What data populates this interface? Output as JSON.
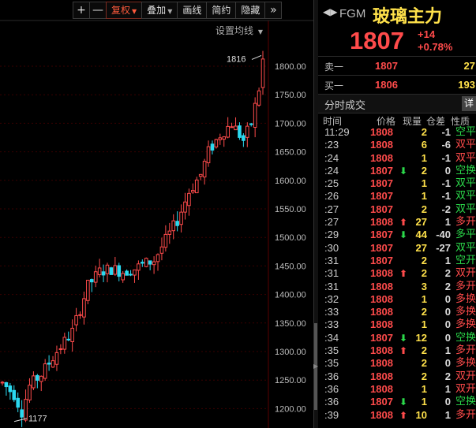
{
  "toolbar": {
    "zoom_in": "+",
    "zoom_out": "—",
    "adjust_label": "复权",
    "overlay_label": "叠加",
    "draw_label": "画线",
    "simple_label": "简约",
    "hide_label": "隐藏",
    "more_label": "»"
  },
  "ma_setting_label": "设置均线",
  "price_axis": [
    "1800.00",
    "1750.00",
    "1700.00",
    "1650.00",
    "1600.00",
    "1550.00",
    "1500.00",
    "1450.00",
    "1400.00",
    "1350.00",
    "1300.00",
    "1250.00",
    "1200.00"
  ],
  "chart_marks": {
    "high_label": "1816",
    "low_label": "1177"
  },
  "colors": {
    "up": "#ff4b4b",
    "down": "#2bd9f0",
    "gridline": "#3a0000",
    "name": "#ffe14a",
    "sell_green": "#2bd94a"
  },
  "header": {
    "arrows": "◀▶",
    "code": "FGM",
    "name": "玻璃主力",
    "price": "1807",
    "change": "+14",
    "change_pct": "+0.78%"
  },
  "sell1": {
    "label": "卖一",
    "price": "1807",
    "volume": "27"
  },
  "buy1": {
    "label": "买一",
    "price": "1806",
    "volume": "193"
  },
  "trades": {
    "title": "分时成交",
    "detail_label": "详",
    "columns": {
      "time": "时间",
      "price": "价格",
      "volume": "现量",
      "oi": "仓差",
      "nature": "性质"
    },
    "rows": [
      {
        "time": "11:29",
        "price": "1808",
        "arrow": "",
        "vol": "2",
        "oi": "-1",
        "nature": "空平",
        "pcolor": "red",
        "ncolor": "green"
      },
      {
        "time": ":23",
        "price": "1808",
        "arrow": "",
        "vol": "6",
        "oi": "-6",
        "nature": "双平",
        "pcolor": "red",
        "ncolor": "red"
      },
      {
        "time": ":24",
        "price": "1808",
        "arrow": "",
        "vol": "1",
        "oi": "-1",
        "nature": "双平",
        "pcolor": "red",
        "ncolor": "red"
      },
      {
        "time": ":24",
        "price": "1807",
        "arrow": "⬇",
        "vol": "2",
        "oi": "0",
        "nature": "空换",
        "pcolor": "red",
        "ncolor": "green"
      },
      {
        "time": ":25",
        "price": "1807",
        "arrow": "",
        "vol": "1",
        "oi": "-1",
        "nature": "双平",
        "pcolor": "red",
        "ncolor": "green"
      },
      {
        "time": ":26",
        "price": "1807",
        "arrow": "",
        "vol": "1",
        "oi": "-1",
        "nature": "双平",
        "pcolor": "red",
        "ncolor": "green"
      },
      {
        "time": ":27",
        "price": "1807",
        "arrow": "",
        "vol": "2",
        "oi": "-2",
        "nature": "双平",
        "pcolor": "red",
        "ncolor": "green"
      },
      {
        "time": ":27",
        "price": "1808",
        "arrow": "⬆",
        "vol": "27",
        "oi": "1",
        "nature": "多开",
        "pcolor": "red",
        "ncolor": "red"
      },
      {
        "time": ":29",
        "price": "1807",
        "arrow": "⬇",
        "vol": "44",
        "oi": "-40",
        "nature": "多平",
        "pcolor": "red",
        "ncolor": "green"
      },
      {
        "time": ":30",
        "price": "1807",
        "arrow": "",
        "vol": "27",
        "oi": "-27",
        "nature": "双平",
        "pcolor": "red",
        "ncolor": "green"
      },
      {
        "time": ":31",
        "price": "1807",
        "arrow": "",
        "vol": "2",
        "oi": "1",
        "nature": "空开",
        "pcolor": "red",
        "ncolor": "green"
      },
      {
        "time": ":31",
        "price": "1808",
        "arrow": "⬆",
        "vol": "2",
        "oi": "2",
        "nature": "双开",
        "pcolor": "red",
        "ncolor": "red"
      },
      {
        "time": ":31",
        "price": "1808",
        "arrow": "",
        "vol": "3",
        "oi": "2",
        "nature": "多开",
        "pcolor": "red",
        "ncolor": "red"
      },
      {
        "time": ":32",
        "price": "1808",
        "arrow": "",
        "vol": "1",
        "oi": "0",
        "nature": "多换",
        "pcolor": "red",
        "ncolor": "red"
      },
      {
        "time": ":33",
        "price": "1808",
        "arrow": "",
        "vol": "2",
        "oi": "0",
        "nature": "多换",
        "pcolor": "red",
        "ncolor": "red"
      },
      {
        "time": ":33",
        "price": "1808",
        "arrow": "",
        "vol": "1",
        "oi": "0",
        "nature": "多换",
        "pcolor": "red",
        "ncolor": "red"
      },
      {
        "time": ":34",
        "price": "1807",
        "arrow": "⬇",
        "vol": "12",
        "oi": "0",
        "nature": "空换",
        "pcolor": "red",
        "ncolor": "green"
      },
      {
        "time": ":35",
        "price": "1808",
        "arrow": "⬆",
        "vol": "2",
        "oi": "1",
        "nature": "多开",
        "pcolor": "red",
        "ncolor": "red"
      },
      {
        "time": ":35",
        "price": "1808",
        "arrow": "",
        "vol": "2",
        "oi": "0",
        "nature": "多换",
        "pcolor": "red",
        "ncolor": "red"
      },
      {
        "time": ":36",
        "price": "1808",
        "arrow": "",
        "vol": "2",
        "oi": "2",
        "nature": "双开",
        "pcolor": "red",
        "ncolor": "red"
      },
      {
        "time": ":36",
        "price": "1808",
        "arrow": "",
        "vol": "1",
        "oi": "1",
        "nature": "双开",
        "pcolor": "red",
        "ncolor": "red"
      },
      {
        "time": ":36",
        "price": "1807",
        "arrow": "⬇",
        "vol": "1",
        "oi": "0",
        "nature": "空换",
        "pcolor": "red",
        "ncolor": "green"
      },
      {
        "time": ":39",
        "price": "1808",
        "arrow": "⬆",
        "vol": "10",
        "oi": "1",
        "nature": "多开",
        "pcolor": "red",
        "ncolor": "red"
      }
    ]
  }
}
